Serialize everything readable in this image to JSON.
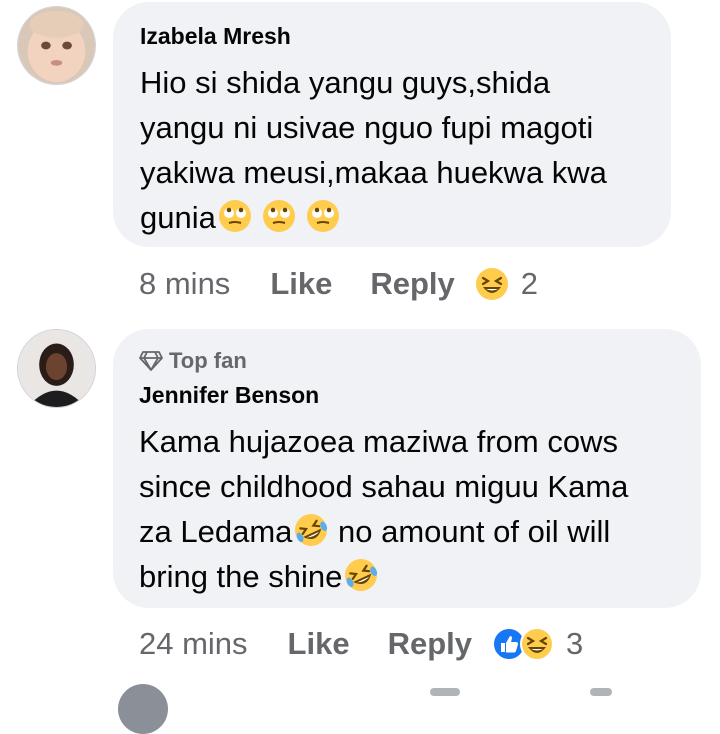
{
  "comments": [
    {
      "author": "Izabela Mresh",
      "badge": "",
      "lines": [
        "Hio si shida yangu guys,shida",
        "yangu ni usivae nguo fupi magoti",
        "yakiwa meusi,makaa huekwa kwa",
        "gunia"
      ],
      "trailing_emojis": [
        "rolling-eyes-emoji",
        "rolling-eyes-emoji",
        "rolling-eyes-emoji"
      ],
      "time": "8 mins",
      "like_label": "Like",
      "reply_label": "Reply",
      "reactions": [
        "laughing-squint-emoji"
      ],
      "reaction_count": "2"
    },
    {
      "author": "Jennifer Benson",
      "badge": "Top fan",
      "lines": [
        "Kama hujazoea maziwa from cows",
        "since childhood sahau miguu Kama",
        "za Ledama",
        "bring the shine"
      ],
      "line3_rest": " no amount of oil will",
      "time": "24 mins",
      "like_label": "Like",
      "reply_label": "Reply",
      "reactions": [
        "like-reaction",
        "laughing-squint-emoji"
      ],
      "reaction_count": "3"
    }
  ],
  "colors": {
    "bubble": "#f0f2f5",
    "meta_text": "#65676b",
    "like_blue": "#1877f2",
    "emoji_yellow": "#ffcc4d"
  }
}
